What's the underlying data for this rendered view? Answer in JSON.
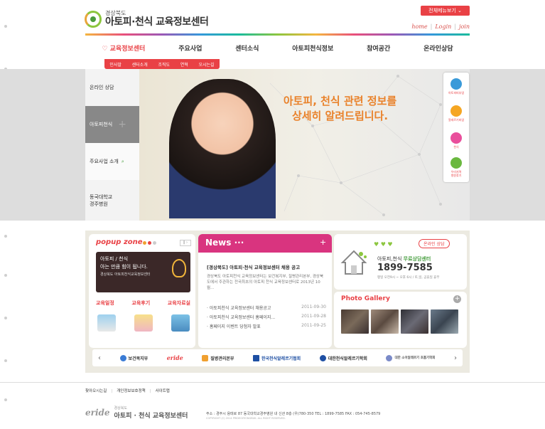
{
  "header": {
    "logo_sub": "경상북도",
    "logo_title": "아토피·천식 교육정보센터",
    "all_menu": "전체메뉴보기",
    "links": [
      "home",
      "Login",
      "join"
    ]
  },
  "nav": {
    "items": [
      "교육정보센터",
      "주요사업",
      "센터소식",
      "아토피천식정보",
      "참여공간",
      "온라인상담"
    ],
    "sub": [
      "인사말",
      "센터소개",
      "조직도",
      "연혁",
      "오시는길"
    ]
  },
  "hero": {
    "line1": "아토피, 천식 관련 정보를",
    "line2": "상세히 알려드립니다.",
    "left": [
      "온라인 상담",
      "아토피천식",
      "주요사업 소개",
      "동국대학교\n경주병원"
    ],
    "right": [
      "아토피피부염",
      "알레르기비염",
      "천식",
      "우리지역\n병원찾기"
    ]
  },
  "popup": {
    "title": "popup zone",
    "banner_l1": "아토피 / 천식",
    "banner_l2": "아는 만큼 힘이 됩니다.",
    "banner_sub": "경상북도 아토피천식교육정보센터",
    "cats": [
      "교육일정",
      "교육후기",
      "교육자료실"
    ]
  },
  "news": {
    "head": "News ···",
    "title": "[경상북도] 아토피·천식 교육정보센터 채용 공고",
    "body": "경상북도 아토피천식 교육정보센터는 보건복지부, 질병관리본부, 경상북도에서 주관하는 전국최초의 아토피 천식 교육정보센터로 2013년 10월...",
    "list": [
      {
        "text": "· 아토피천식 교육정보센터 채용공고",
        "date": "2011-09-30"
      },
      {
        "text": "· 아토피천식 교육정보센터 홈페이지...",
        "date": "2011-09-28"
      },
      {
        "text": "· 홈페이지 이벤트 당첨자 발표",
        "date": "2011-09-25"
      }
    ]
  },
  "counsel": {
    "badge": "온라인 상담",
    "title_a": "아토피,천식 ",
    "title_b": "무료상담센터",
    "phone": "1899-7585",
    "hours": "평일 오전9시 ~ 오후 6시 / 토,일, 공휴일 휴무"
  },
  "gallery": {
    "title": "Photo Gallery"
  },
  "partners": [
    "보건복지부",
    "eride",
    "질병관리본부",
    "한국천식알레르기협회",
    "대한천식알레르기학회",
    "대한 소아알레르기 호흡기학회"
  ],
  "footer": {
    "links": [
      "찾아오시는길",
      "개인정보보호정책",
      "사이트맵"
    ],
    "logo_mark": "eride",
    "logo_sub": "경상북도",
    "logo_title": "아토피 · 천식 교육정보센터",
    "addr": "주소 : 경주시 용태로 87 동국대학교경주병원 내 신관 8층 (우)780-350 TEL : 1899-7585 FAX : 054-745-8579",
    "copy": "COPYRIGHT (C) 2014 PRIDEGYEONGBUK. ALL RIGHT RESERVED."
  }
}
